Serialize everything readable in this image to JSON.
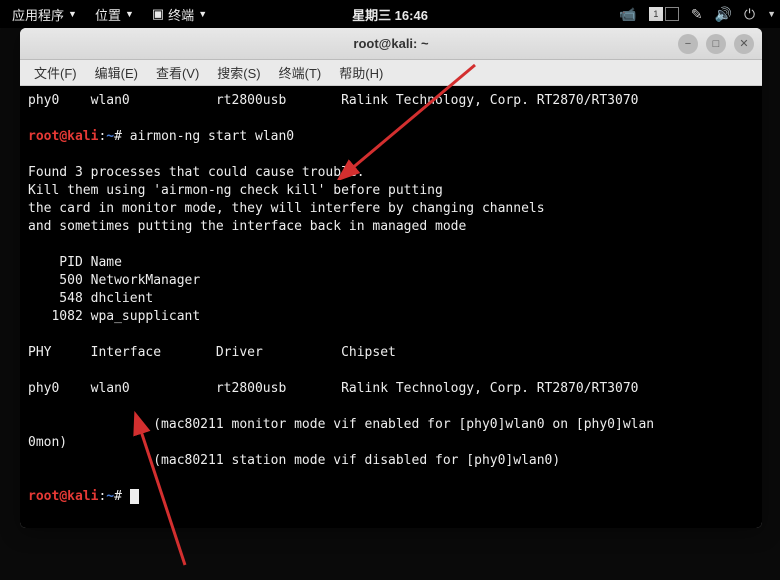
{
  "top_panel": {
    "apps": "应用程序",
    "places": "位置",
    "terminal": "终端",
    "datetime": "星期三 16:46",
    "workspace_active": "1"
  },
  "window": {
    "title": "root@kali: ~"
  },
  "menubar": {
    "file": "文件(F)",
    "edit": "编辑(E)",
    "view": "查看(V)",
    "search": "搜索(S)",
    "terminal": "终端(T)",
    "help": "帮助(H)"
  },
  "prompt": {
    "user": "root",
    "at": "@",
    "host": "kali",
    "colon": ":",
    "path": "~",
    "hash": "# "
  },
  "terminal": {
    "line_phy_top": "phy0    wlan0           rt2800usb       Ralink Technology, Corp. RT2870/RT3070",
    "cmd1": "airmon-ng start wlan0",
    "found": "Found 3 processes that could cause trouble.",
    "kill1": "Kill them using 'airmon-ng check kill' before putting",
    "kill2": "the card in monitor mode, they will interfere by changing channels",
    "kill3": "and sometimes putting the interface back in managed mode",
    "pid_header": "    PID Name",
    "pid1": "    500 NetworkManager",
    "pid2": "    548 dhclient",
    "pid3": "   1082 wpa_supplicant",
    "header2": "PHY     Interface       Driver          Chipset",
    "line_phy_bot": "phy0    wlan0           rt2800usb       Ralink Technology, Corp. RT2870/RT3070",
    "mac1": "                (mac80211 monitor mode vif enabled for [phy0]wlan0 on [phy0]wlan",
    "mac1b": "0mon)",
    "mac2": "                (mac80211 station mode vif disabled for [phy0]wlan0)"
  }
}
